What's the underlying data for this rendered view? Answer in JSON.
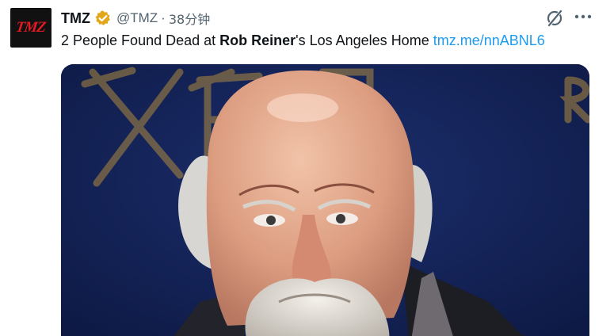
{
  "account": {
    "avatar_text": "TMZ",
    "name": "TMZ",
    "handle": "@TMZ",
    "separator": "·",
    "time": "38分钟",
    "verified_color": "#e2a81c"
  },
  "tweet": {
    "text_prefix": "2 People Found Dead at ",
    "text_bold": "Rob Reiner",
    "text_suffix": "'s Los Angeles Home ",
    "link": "tmz.me/nnABNL6"
  },
  "icons": {
    "grok": "grok-icon",
    "more": "more-icon",
    "verified": "verified-badge-icon"
  },
  "colors": {
    "text": "#0f1419",
    "secondary": "#536471",
    "link": "#1d9bf0",
    "media_background": "#0f1d4a",
    "backdrop_emblem": "#b08a3e"
  }
}
